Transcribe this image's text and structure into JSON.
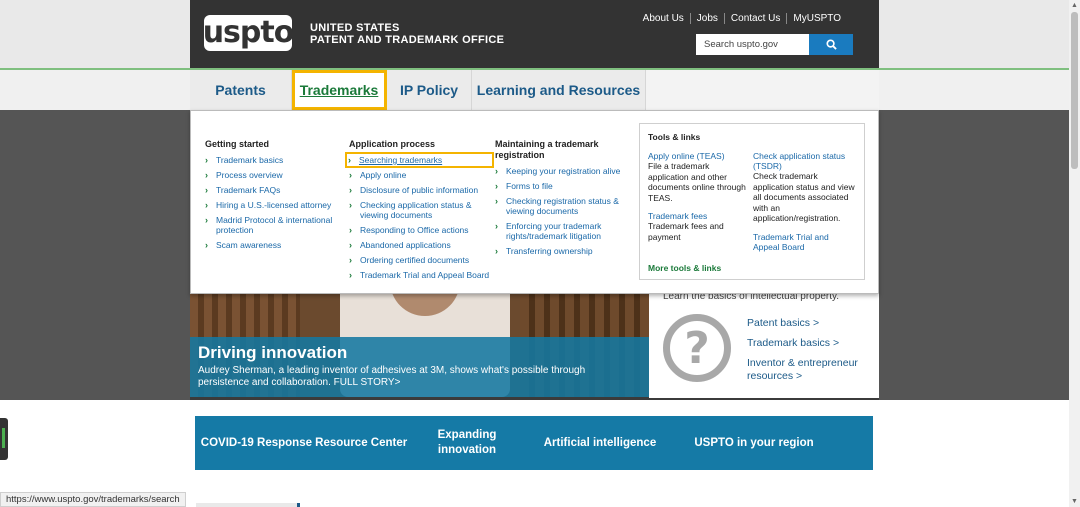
{
  "header": {
    "logo": "uspto",
    "org_line1": "UNITED STATES",
    "org_line2": "PATENT AND TRADEMARK OFFICE",
    "top_links": [
      "About Us",
      "Jobs",
      "Contact Us",
      "MyUSPTO"
    ],
    "search_placeholder": "Search uspto.gov",
    "search_icon": "magnifier-icon"
  },
  "nav": {
    "items": [
      "Patents",
      "Trademarks",
      "IP Policy",
      "Learning and Resources"
    ],
    "active": "Trademarks"
  },
  "menu": {
    "col1": {
      "head": "Getting started",
      "items": [
        "Trademark basics",
        "Process overview",
        "Trademark FAQs",
        "Hiring a U.S.-licensed attorney",
        "Madrid Protocol & international protection",
        "Scam awareness"
      ]
    },
    "col2": {
      "head": "Application process",
      "items": [
        "Searching trademarks",
        "Apply online",
        "Disclosure of public information",
        "Checking application status & viewing documents",
        "Responding to Office actions",
        "Abandoned applications",
        "Ordering certified documents",
        "Trademark Trial and Appeal Board"
      ]
    },
    "col3": {
      "head": "Maintaining a trademark registration",
      "items": [
        "Keeping your registration alive",
        "Forms to file",
        "Checking registration status & viewing documents",
        "Enforcing your trademark rights/trademark litigation",
        "Transferring ownership"
      ]
    },
    "tools": {
      "head": "Tools & links",
      "teas_link": "Apply online (TEAS)",
      "teas_desc": "File a trademark application and other documents online through TEAS.",
      "fees_link": "Trademark fees",
      "fees_desc": "Trademark fees and payment",
      "tsdr_link": "Check application status (TSDR)",
      "tsdr_desc": "Check trademark application status and view all documents associated with an application/registration.",
      "ttab_link": "Trademark Trial and Appeal Board",
      "more": "More tools & links"
    }
  },
  "hero": {
    "title": "Driving innovation",
    "text": "Audrey Sherman, a leading inventor of adhesives at 3M, shows what's possible through persistence and collaboration. FULL STORY>"
  },
  "info": {
    "intro": "Learn the basics of intellectual property.",
    "links": [
      "Patent basics >",
      "Trademark basics >",
      "Inventor & entrepreneur resources >"
    ]
  },
  "bluebar": [
    "COVID-19 Response Resource Center",
    "Expanding innovation",
    "Artificial intelligence",
    "USPTO in your region"
  ],
  "status_url": "https://www.uspto.gov/trademarks/search"
}
